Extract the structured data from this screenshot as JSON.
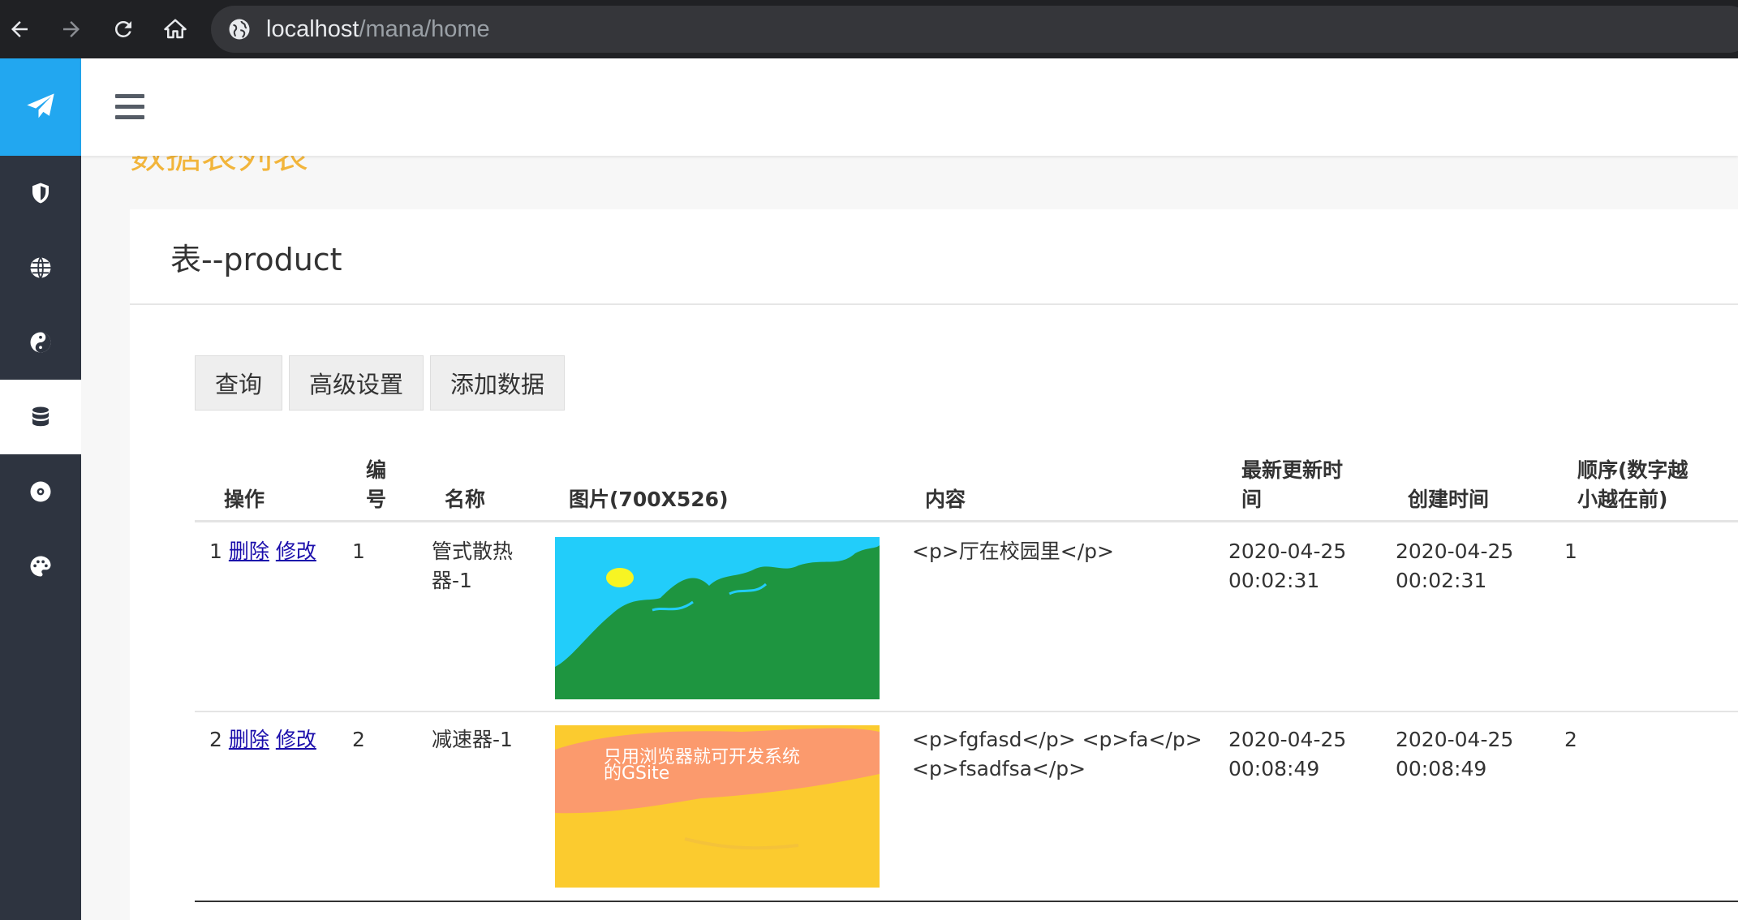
{
  "browser": {
    "url_host": "localhost",
    "url_path": "/mana/home"
  },
  "sidebar": {
    "logo_icon": "paper-plane-icon",
    "accent_color": "#22a7f0",
    "items": [
      {
        "icon": "shield-icon"
      },
      {
        "icon": "globe-icon"
      },
      {
        "icon": "yin-yang-icon"
      },
      {
        "icon": "database-icon",
        "active": true
      },
      {
        "icon": "disc-icon"
      },
      {
        "icon": "palette-icon"
      }
    ]
  },
  "page": {
    "title": "数据表列表",
    "card_title": "表--product"
  },
  "toolbar": {
    "query_label": "查询",
    "advanced_label": "高级设置",
    "add_label": "添加数据"
  },
  "table": {
    "headers": {
      "op": "操作",
      "id_line1": "编",
      "id_line2": "号",
      "name": "名称",
      "image": "图片(700X526)",
      "content": "内容",
      "updated_line1": "最新更新时",
      "updated_line2": "间",
      "created": "创建时间",
      "order_line1": "顺序(数字越",
      "order_line2": "小越在前)"
    },
    "delete_label": "删除",
    "edit_label": "修改",
    "rows": [
      {
        "index": "1",
        "id": "1",
        "name_line1": "管式散热",
        "name_line2": "器-1",
        "content_line1": "<p>厅在校园里</p>",
        "content_line2": "",
        "updated_date": "2020-04-25",
        "updated_time": "00:02:31",
        "created_date": "2020-04-25",
        "created_time": "00:02:31",
        "order": "1"
      },
      {
        "index": "2",
        "id": "2",
        "name_line1": "减速器-1",
        "name_line2": "",
        "content_line1": "<p>fgfasd</p> <p>fa</p>",
        "content_line2": "<p>fsadfsa</p>",
        "updated_date": "2020-04-25",
        "updated_time": "00:08:49",
        "created_date": "2020-04-25",
        "created_time": "00:08:49",
        "order": "2",
        "image_text_line1": "只用浏览器就可开发系统",
        "image_text_line2": "的GSite"
      }
    ]
  }
}
